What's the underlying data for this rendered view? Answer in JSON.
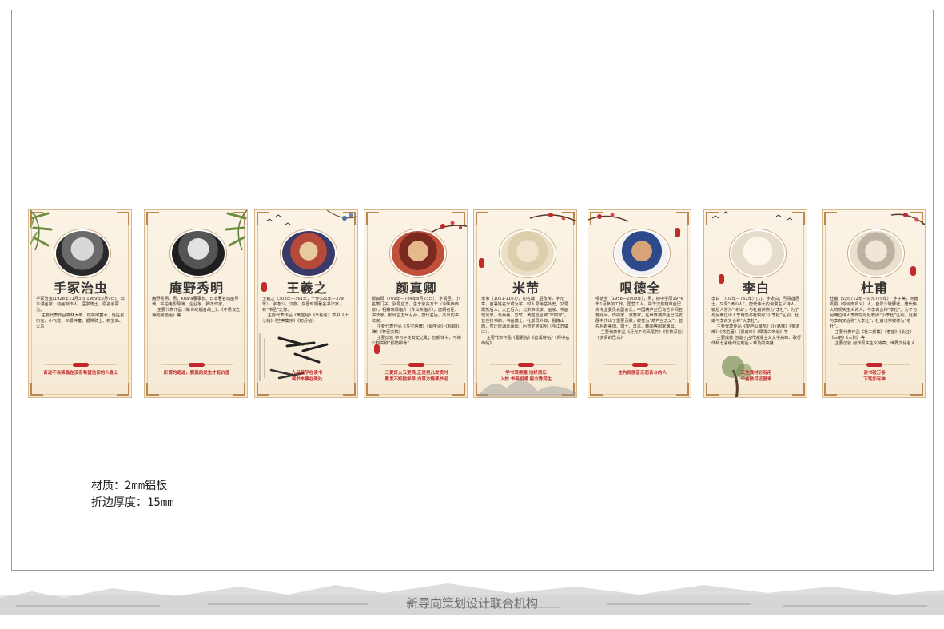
{
  "cards": [
    {
      "name": "手冢治虫",
      "bio": "手冢治虫(1928年11月3日-1989年2月9日)，日本漫画家、动画制作人、医学博士，原名手冢治。\n    主要代表作品森林大帝、铁臂阿童木、怪医黑杰克、小飞龙、三眼神童、银带骑士、新宝岛、火鸟",
      "motto": "奇迹不会降临在没有希望信仰的人身上"
    },
    {
      "name": "庵野秀明",
      "bio": "庵野秀明，男，Khara董事长、日本著名动画导演、实拍电影导演、企业家、脚本作家。\n    主要代表作品《新世纪福音战士》、《不思议之海的娜迪娅》等",
      "motto": "所谓的奇迹，要真的发生才有价值"
    },
    {
      "name": "王羲之",
      "bio": "王羲之（303年—361年，一作321年—379年），字逸少，汉族，东晋时期著名书法家，有“书圣”之称。\n    主要代表作品《黄庭经》《乐毅论》草书《十七帖》《兰亭集序》《初月帖》",
      "motto": "人品若乎在读书\n读书本事在两处"
    },
    {
      "name": "颜真卿",
      "bio": "颜真卿（709年—784年8月23日），字清臣，小名羡门子，别号应方，生于京兆万年（今陕西西安），祖籍琅琊临沂（今山东临沂）。唐朝名臣、书法家，颜师古五世从孙，唐代名臣，杰出的书法家。\n    主要代表作品《多宝塔碑》《勤学诗》《颜勤礼碑》《祭侄文稿》\n    主要成就 参与平定安史之乱；创颜体书，与柳公权并称“颜筋柳骨”",
      "motto": "三更灯火五更鸡,正是男儿发愤时\n黑发不知勤学早,白首方悔读书迟"
    },
    {
      "name": "米芾",
      "bio": "米芾（1051-1107），初名黻，后改芾，字元章，自署姓名米或为芊，时人号海岳外史，又号鬻熊后人、火正后人。北宋书法家、画家、书画理论家，与蔡襄、苏轼、黄庭坚合称“宋四家”。曾任校书郎、书画博士、礼部员外郎，祖籍山西，然迁居湖北襄阳，后曾定居润州（今江苏镇江）。\n    主要代表作品《蜀素帖》《苕溪诗帖》《拜中岳命帖》",
      "motto": "学书须得趣 他好俱忘\n入妙 书画相通 秘方秀润生"
    },
    {
      "name": "哏德全",
      "bio": "哏德全（1958—2008年），男，初中学历1976年1月参加工作，国营工人，中华汉族葫芦丝巴乌专业委员会副会长，中国葫芦丝巴乌艺术网名誉顾问，作曲家、演奏家。在世界葫芦丝巴乌发展中作出了重要贡献，被誉为“葫芦丝之父”。曾先后赴美国、瑞士、日本、韩国等国家演出。\n    主要代表作品《月光下的凤尾竹》《竹林深处》《多情的巴乌》",
      "motto": "一生为民族音乐而奋斗的人"
    },
    {
      "name": "李白",
      "bio": "李白（701年－762年）[1]，字太白，号青莲居士，又号“谪仙人”，唐代伟大的浪漫主义诗人，被后人誉为“诗仙”，与杜甫并称为“李杜”，为了与另两位诗人李商隐与杜牧即“小李杜”区别，杜甫与李白又合称“大李杜”。\n    主要代表作品《望庐山瀑布》《行路难》《蜀道难》《将进酒》《梁甫吟》《早发白帝城》等\n    主要成就 创造了古代浪漫主义文学高峰、歌行体和七言绝句达到后人难及的高度",
      "motto": "天生我材必有用\n千金散尽还复来"
    },
    {
      "name": "杜甫",
      "bio": "杜甫（公元712年－公元770年），字子美，河南巩县（今河南巩义）人，自号少陵野老，唐代伟大的现实主义诗人，与李白合称“李杜”。为了与另两位诗人李商隐与杜牧即“小李杜”区别，杜甫与李白又合称“大李杜”，杜甫也常被称为“老杜”。\n    主要代表作品《杜工部集》《春望》《北征》《三吏》《三别》等\n    主要成就 创作现实主义诗章；世界文化名人",
      "motto": "读书破万卷\n下笔如有神"
    }
  ],
  "spec": {
    "material": "材质：2mm铝板",
    "thickness": "折边厚度：15mm"
  },
  "footer": {
    "org": "新导向策划设计联合机构"
  },
  "colors": {
    "accent_red": "#c0282d",
    "border_gold": "#b9874f",
    "card_bg": "#f8eedb"
  }
}
